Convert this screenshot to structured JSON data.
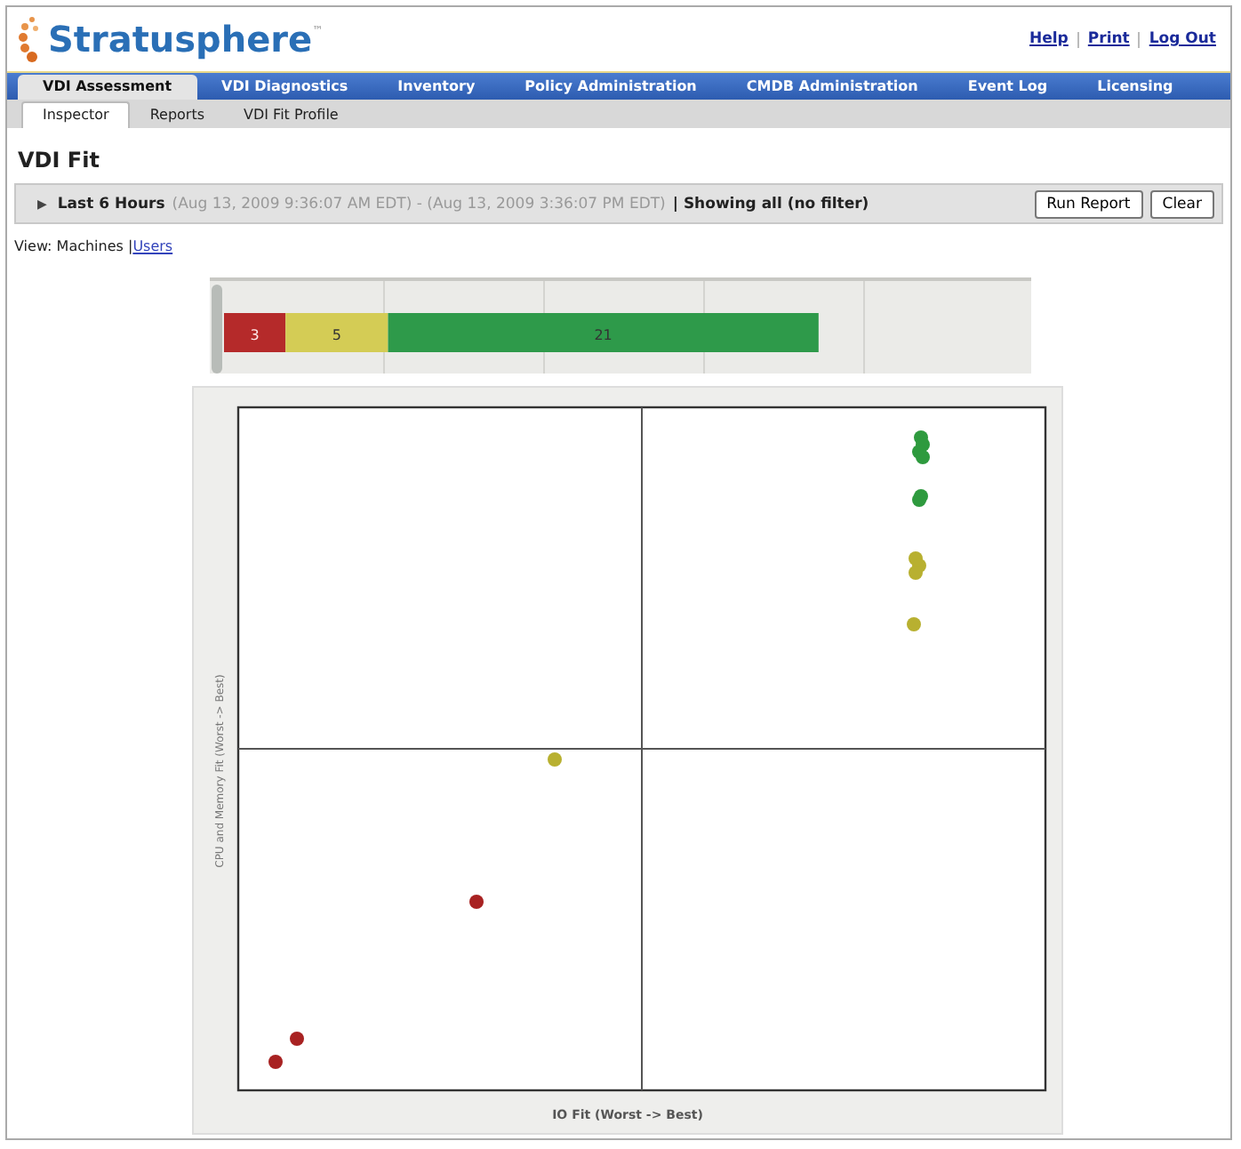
{
  "header": {
    "logo": "Stratusphere",
    "logo_mark": "™",
    "links": [
      "Help",
      "Print",
      "Log Out"
    ]
  },
  "tabs": [
    {
      "label": "VDI Assessment",
      "selected": true
    },
    {
      "label": "VDI Diagnostics",
      "selected": false
    },
    {
      "label": "Inventory",
      "selected": false
    },
    {
      "label": "Policy Administration",
      "selected": false
    },
    {
      "label": "CMDB Administration",
      "selected": false
    },
    {
      "label": "Event Log",
      "selected": false
    },
    {
      "label": "Licensing",
      "selected": false
    }
  ],
  "subtabs": [
    {
      "label": "Inspector",
      "selected": true
    },
    {
      "label": "Reports",
      "selected": false
    },
    {
      "label": "VDI Fit Profile",
      "selected": false
    }
  ],
  "page_title": "VDI Fit",
  "filter_bar": {
    "expander": "▶",
    "range": "Last 6 Hours",
    "span": "(Aug 13, 2009 9:36:07 AM EDT) - (Aug 13, 2009 3:36:07 PM EDT)",
    "filter": "| Showing all (no filter)",
    "buttons": [
      "Run Report",
      "Clear"
    ]
  },
  "view": {
    "label": "View: Machines |",
    "link": "Users"
  },
  "summary": {
    "chart_data": {
      "type": "bar",
      "orientation": "horizontal",
      "stacked": true,
      "data_labels": true,
      "series": [
        {
          "color": "#b52a2a",
          "values": [
            3
          ]
        },
        {
          "color": "#d4cc55",
          "values": [
            5
          ]
        },
        {
          "color": "#2e9a4a",
          "values": [
            21
          ]
        }
      ]
    }
  },
  "scatter": {
    "ylabel": "CPU and Memory Fit (Worst -> Best)",
    "xlabel": "IO Fit (Worst -> Best)"
  }
}
